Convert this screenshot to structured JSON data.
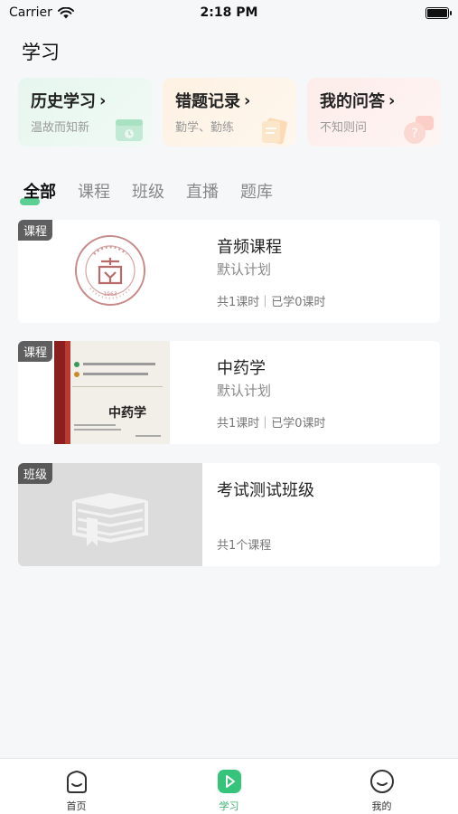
{
  "status": {
    "carrier": "Carrier",
    "time": "2:18 PM"
  },
  "page": {
    "title": "学习"
  },
  "quick_links": [
    {
      "title": "历史学习",
      "subtitle": "温故而知新",
      "chevron": "›",
      "icon": "calendar-icon",
      "color": "#35c47a"
    },
    {
      "title": "错题记录",
      "subtitle": "勤学、勤练",
      "chevron": "›",
      "icon": "notes-icon",
      "color": "#f0a04b"
    },
    {
      "title": "我的问答",
      "subtitle": "不知则问",
      "chevron": "›",
      "icon": "question-icon",
      "color": "#f07a6b"
    }
  ],
  "tabs": [
    {
      "label": "全部",
      "active": true
    },
    {
      "label": "课程",
      "active": false
    },
    {
      "label": "班级",
      "active": false
    },
    {
      "label": "直播",
      "active": false
    },
    {
      "label": "题库",
      "active": false
    }
  ],
  "cards": [
    {
      "tag": "课程",
      "title": "音频课程",
      "plan": "默认计划",
      "meta": "共1课时｜已学0课时",
      "thumb": "university-seal",
      "seal_year": "1963"
    },
    {
      "tag": "课程",
      "title": "中药学",
      "plan": "默认计划",
      "meta": "共1课时｜已学0课时",
      "thumb": "book-cover",
      "cover_title": "中药学"
    },
    {
      "tag": "班级",
      "title": "考试测试班级",
      "plan": "",
      "meta": "共1个课程",
      "thumb": "books-placeholder"
    }
  ],
  "bottom_nav": [
    {
      "label": "首页",
      "icon": "home-icon",
      "active": false
    },
    {
      "label": "学习",
      "icon": "play-icon",
      "active": true
    },
    {
      "label": "我的",
      "icon": "profile-icon",
      "active": false
    }
  ],
  "colors": {
    "accent": "#35c47a",
    "background": "#f6f7f9"
  }
}
